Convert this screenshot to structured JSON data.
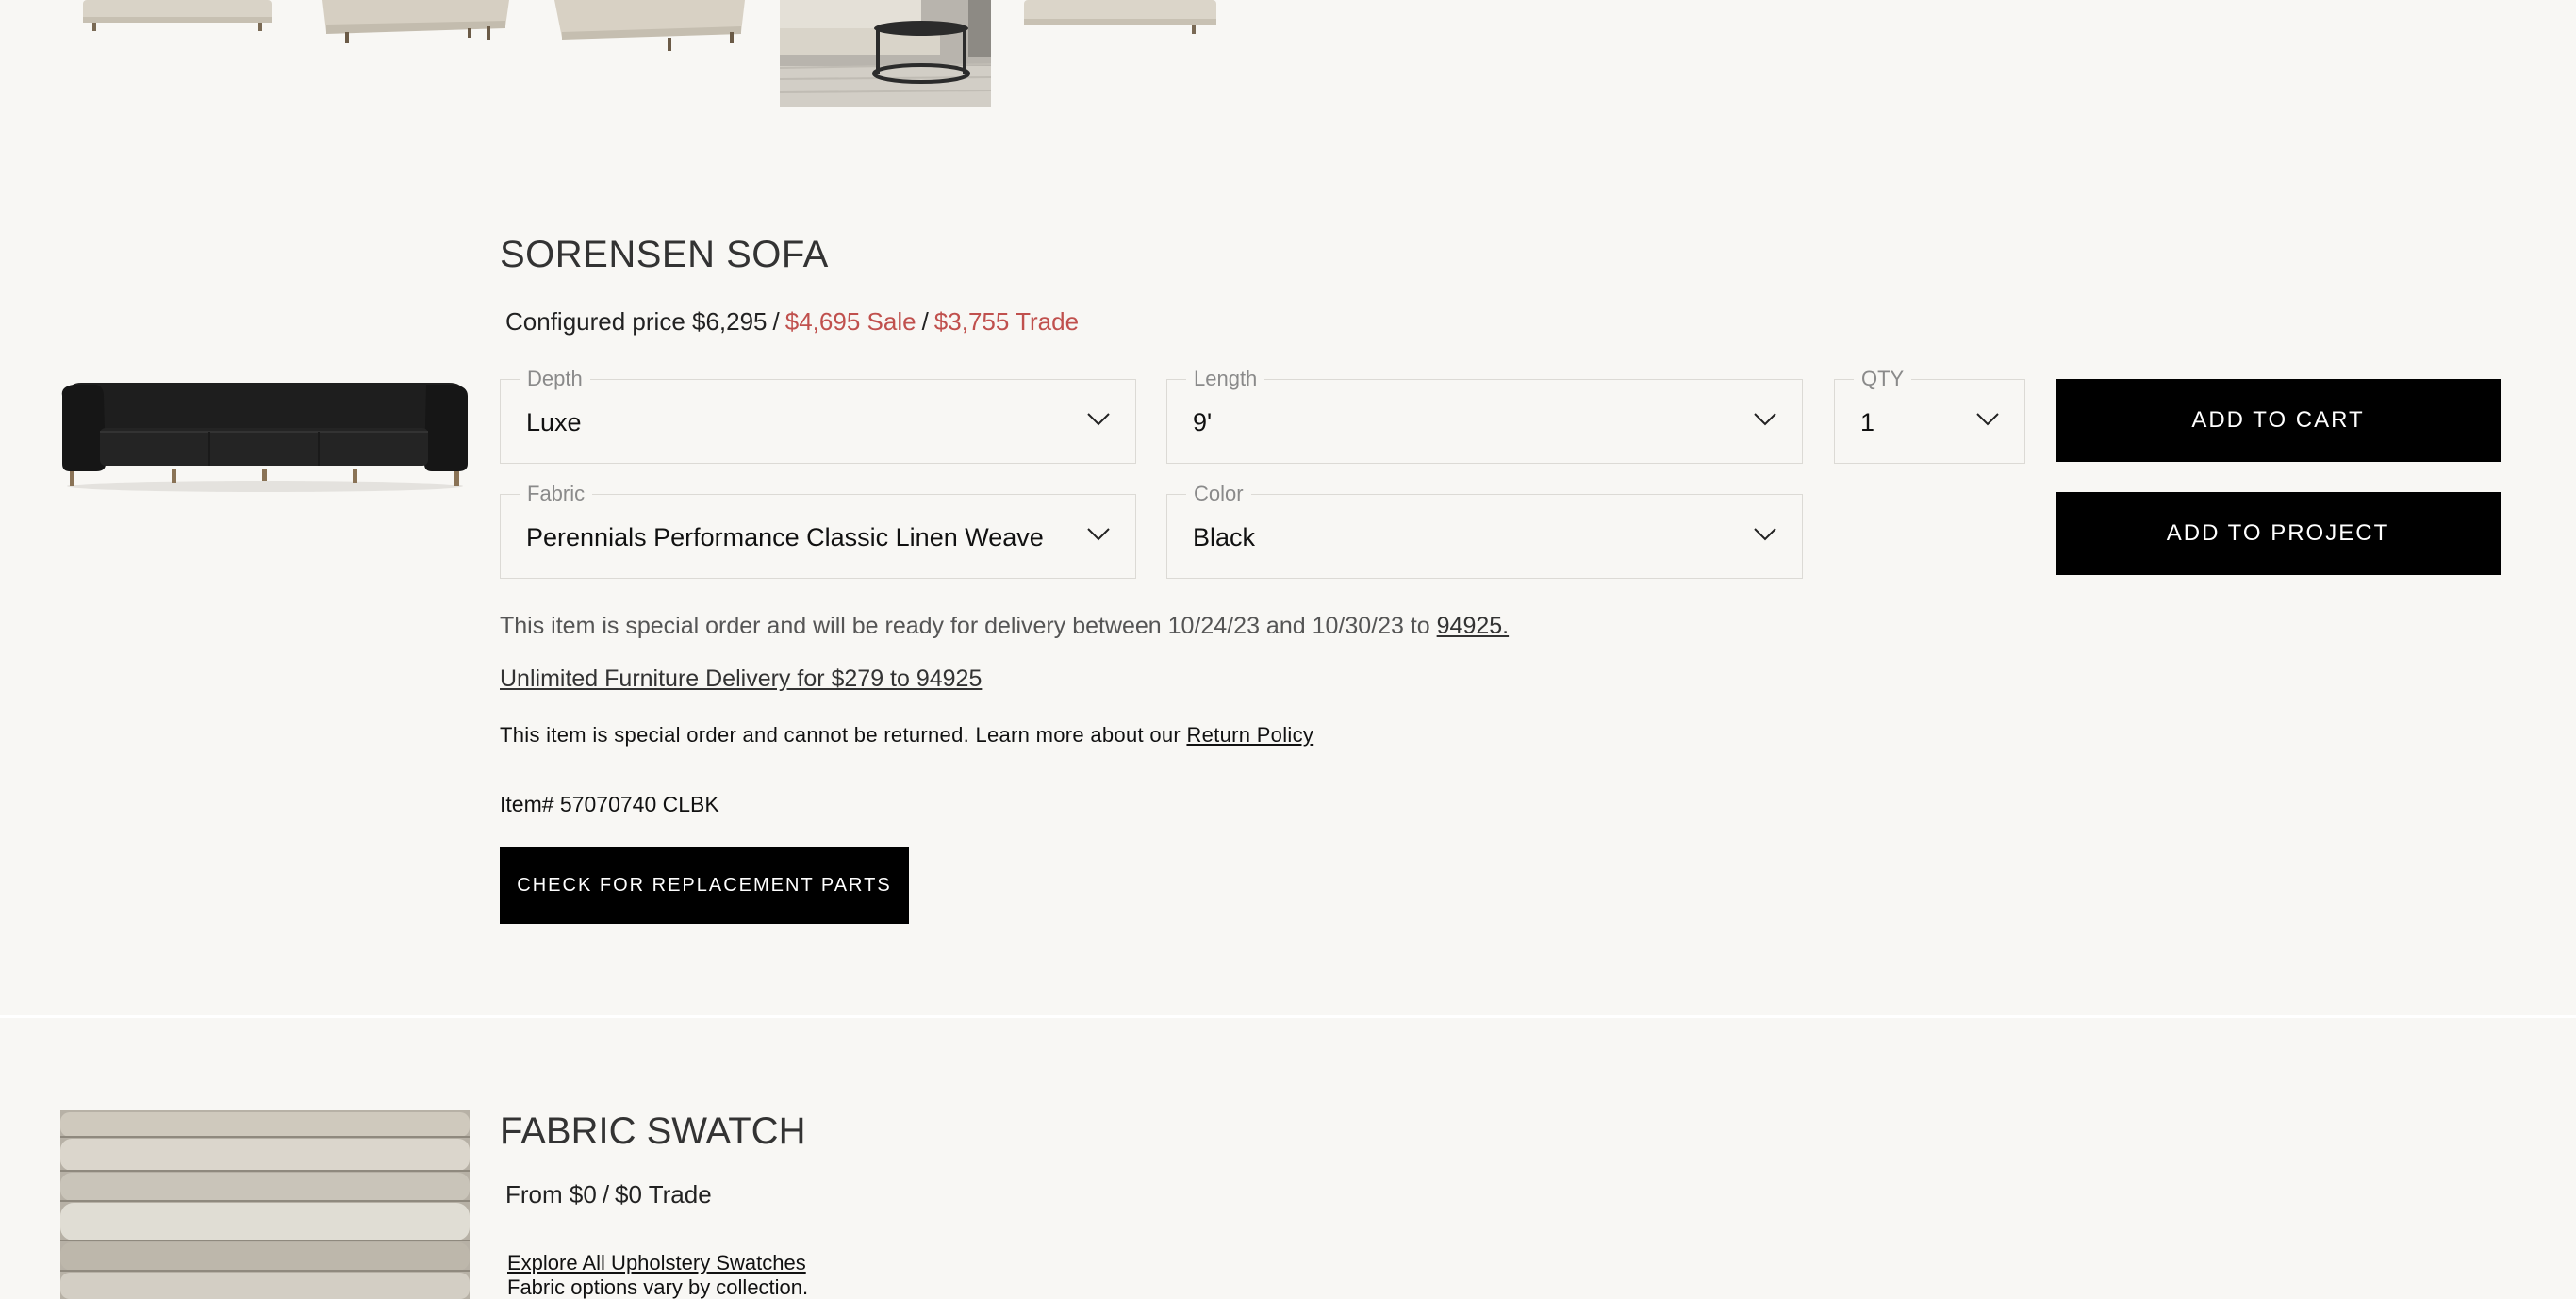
{
  "thumbnails": [
    {
      "name": "sofa-front-view"
    },
    {
      "name": "sofa-angle-view"
    },
    {
      "name": "sofa-side-view"
    },
    {
      "name": "sofa-room-scene"
    },
    {
      "name": "sofa-back-view"
    }
  ],
  "product": {
    "title": "SORENSEN SOFA",
    "price_label": "Configured price $6,295",
    "sale_label": "$4,695 Sale",
    "trade_label": "$3,755 Trade",
    "separator": "/",
    "options": {
      "depth": {
        "label": "Depth",
        "value": "Luxe"
      },
      "length": {
        "label": "Length",
        "value": "9'"
      },
      "qty": {
        "label": "QTY",
        "value": "1"
      },
      "fabric": {
        "label": "Fabric",
        "value": "Perennials Performance Classic Linen Weave"
      },
      "color": {
        "label": "Color",
        "value": "Black"
      }
    },
    "add_to_cart": "ADD TO CART",
    "add_to_project": "ADD TO PROJECT",
    "delivery_text": "This item is special order and will be ready for delivery between 10/24/23 and 10/30/23 to",
    "delivery_zip": "94925.",
    "unlimited_delivery": "Unlimited Furniture Delivery for $279 to 94925",
    "returns_text": "This item is special order and cannot be returned. Learn more about our",
    "return_policy": "Return Policy",
    "item_number": "Item# 57070740 CLBK",
    "replacement_parts": "CHECK FOR REPLACEMENT PARTS"
  },
  "swatch": {
    "title": "FABRIC SWATCH",
    "price_label": "From $0",
    "trade_label": "$0 Trade",
    "separator": "/",
    "explore_link": "Explore All Upholstery Swatches",
    "note": "Fabric options vary by collection."
  },
  "colors": {
    "background": "#f8f7f4",
    "sale": "#c0504d",
    "button": "#000000",
    "border": "#dcdad5"
  }
}
